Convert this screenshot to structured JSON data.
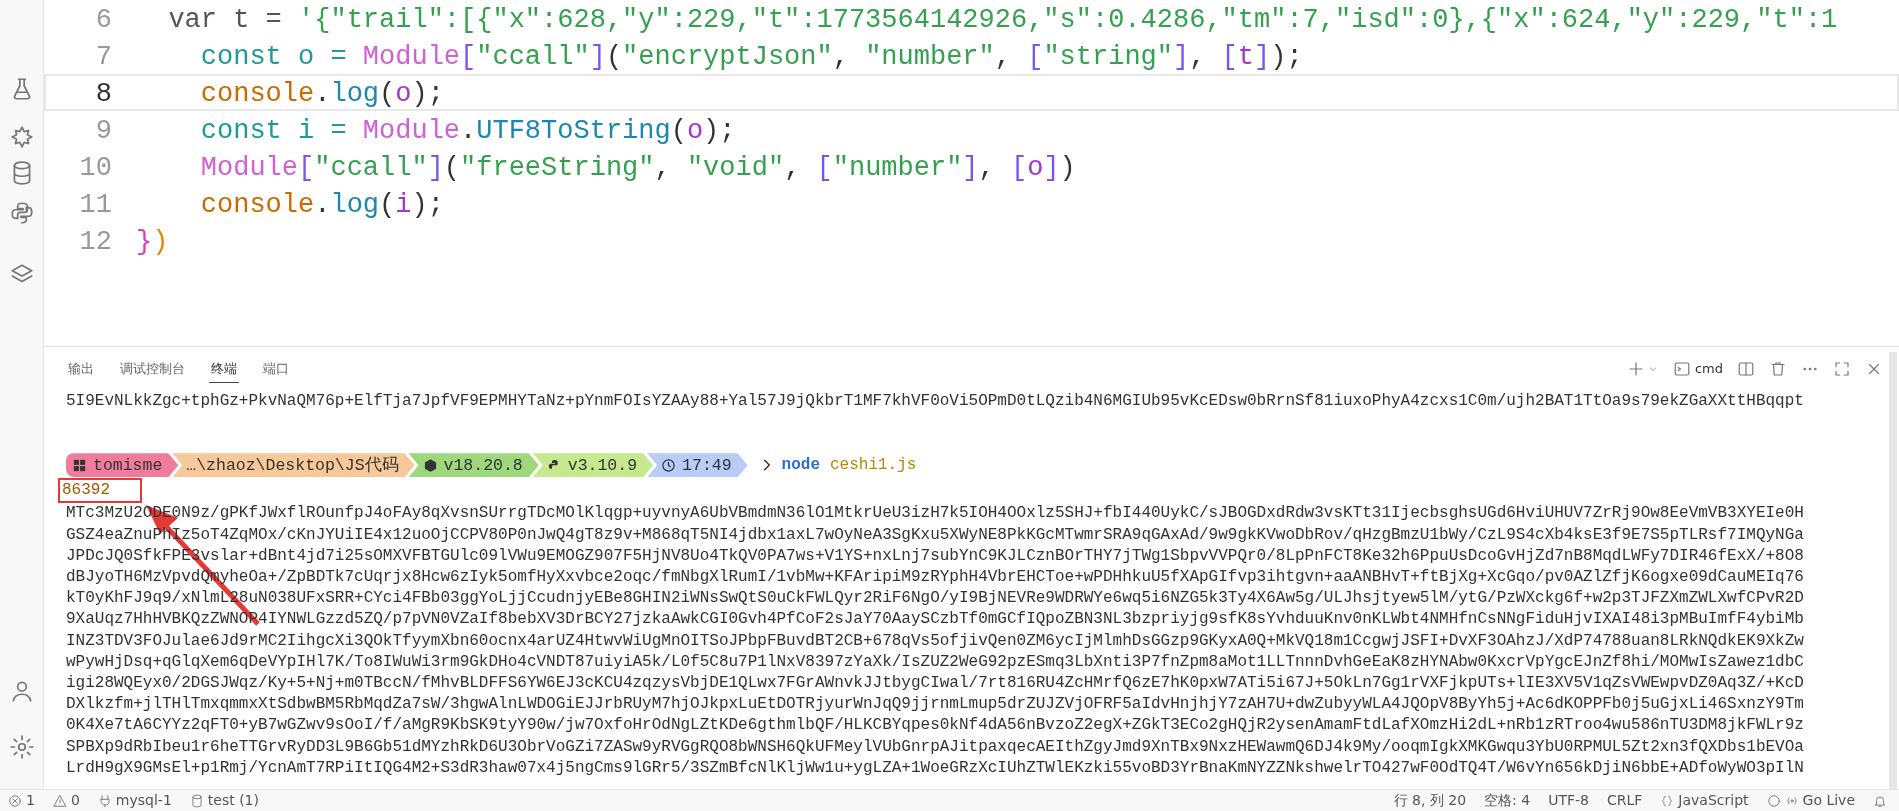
{
  "editor": {
    "lines": [
      {
        "number": "6",
        "current": false,
        "tokens": [
          {
            "text": "  var t = ",
            "kind": "plain"
          },
          {
            "text": "'{\"trail\":[{\"x\":628,\"y\":229,\"t\":1773564142926,\"s\":0.4286,\"tm\":7,\"isd\":0},{\"x\":624,\"y\":229,\"t\":1",
            "kind": "str"
          }
        ]
      },
      {
        "number": "7",
        "current": false,
        "tokens": [
          {
            "text": "    const o = ",
            "kind": "kw"
          },
          {
            "text": "Module",
            "kind": "mod"
          },
          {
            "text": "[",
            "kind": "br"
          },
          {
            "text": "\"ccall\"",
            "kind": "str"
          },
          {
            "text": "]",
            "kind": "br"
          },
          {
            "text": "(",
            "kind": "punc"
          },
          {
            "text": "\"encryptJson\"",
            "kind": "str"
          },
          {
            "text": ", ",
            "kind": "punc"
          },
          {
            "text": "\"number\"",
            "kind": "str"
          },
          {
            "text": ", ",
            "kind": "punc"
          },
          {
            "text": "[",
            "kind": "br"
          },
          {
            "text": "\"string\"",
            "kind": "str"
          },
          {
            "text": "]",
            "kind": "br"
          },
          {
            "text": ", ",
            "kind": "punc"
          },
          {
            "text": "[",
            "kind": "br"
          },
          {
            "text": "t",
            "kind": "param"
          },
          {
            "text": "]",
            "kind": "br"
          },
          {
            "text": ");",
            "kind": "punc"
          }
        ]
      },
      {
        "number": "8",
        "current": true,
        "tokens": [
          {
            "text": "    console",
            "kind": "obj"
          },
          {
            "text": ".",
            "kind": "punc"
          },
          {
            "text": "log",
            "kind": "fn"
          },
          {
            "text": "(",
            "kind": "punc"
          },
          {
            "text": "o",
            "kind": "param"
          },
          {
            "text": ");",
            "kind": "punc"
          }
        ]
      },
      {
        "number": "9",
        "current": false,
        "tokens": [
          {
            "text": "    const i = ",
            "kind": "kw"
          },
          {
            "text": "Module",
            "kind": "mod"
          },
          {
            "text": ".",
            "kind": "punc"
          },
          {
            "text": "UTF8ToString",
            "kind": "fn"
          },
          {
            "text": "(",
            "kind": "punc"
          },
          {
            "text": "o",
            "kind": "param"
          },
          {
            "text": ");",
            "kind": "punc"
          }
        ]
      },
      {
        "number": "10",
        "current": false,
        "tokens": [
          {
            "text": "    Module",
            "kind": "mod"
          },
          {
            "text": "[",
            "kind": "br"
          },
          {
            "text": "\"ccall\"",
            "kind": "str"
          },
          {
            "text": "]",
            "kind": "br"
          },
          {
            "text": "(",
            "kind": "punc"
          },
          {
            "text": "\"freeString\"",
            "kind": "str"
          },
          {
            "text": ", ",
            "kind": "punc"
          },
          {
            "text": "\"void\"",
            "kind": "str"
          },
          {
            "text": ", ",
            "kind": "punc"
          },
          {
            "text": "[",
            "kind": "br"
          },
          {
            "text": "\"number\"",
            "kind": "str"
          },
          {
            "text": "]",
            "kind": "br"
          },
          {
            "text": ", ",
            "kind": "punc"
          },
          {
            "text": "[",
            "kind": "br"
          },
          {
            "text": "o",
            "kind": "param"
          },
          {
            "text": "]",
            "kind": "br"
          },
          {
            "text": ")",
            "kind": "punc"
          }
        ]
      },
      {
        "number": "11",
        "current": false,
        "tokens": [
          {
            "text": "    console",
            "kind": "obj"
          },
          {
            "text": ".",
            "kind": "punc"
          },
          {
            "text": "log",
            "kind": "fn"
          },
          {
            "text": "(",
            "kind": "punc"
          },
          {
            "text": "i",
            "kind": "param"
          },
          {
            "text": ");",
            "kind": "punc"
          }
        ]
      },
      {
        "number": "12",
        "current": false,
        "tokens": [
          {
            "text": "}",
            "kind": "brace1"
          },
          {
            "text": ")",
            "kind": "brace2"
          }
        ]
      }
    ]
  },
  "panel": {
    "tabs": [
      {
        "label": "输出",
        "selected": false
      },
      {
        "label": "调试控制台",
        "selected": false
      },
      {
        "label": "终端",
        "selected": true
      },
      {
        "label": "端口",
        "selected": false
      }
    ],
    "shell": "cmd",
    "terminal": {
      "previous_output": "5I9EvNLkkZgc+tphGz+PkvNaQM76p+ElfTja7JpfVF9EPMHYTaNz+pYnmFOIsYZAAy88+Yal57J9jQkbrT1MF7khVF0oVi5OPmD0tLQzib4N6MGIUb95vKcEDsw0bRrnSf81iuxoPhyA4zcxs1C0m/ujh2BAT1TtOa9s79ekZGaXXttHBqqpt",
      "prompt": [
        {
          "text": "tomisme",
          "kind": "user"
        },
        {
          "text": "…\\zhaoz\\Desktop\\JS代码",
          "kind": "path"
        },
        {
          "text": "v18.20.8",
          "kind": "node"
        },
        {
          "text": "v3.10.9",
          "kind": "python"
        },
        {
          "text": "17:49",
          "kind": "time"
        }
      ],
      "command": "node",
      "argument": "ceshi1.js",
      "result": "86392",
      "output": [
        "MTc3MzU2ODE0N9z/gPKfJWxflROunfpJ4oFAy8qXvsnSUrrgTDcMOlKlqgp+uyvnyA6UbVBmdmN36lO1MtkrUeU3izH7k5IOH4OOxlz5SHJ+fbI440UykC/sJBOGDxdRdw3vsKTt31IjecbsghsUGd6HviUHUV7ZrRj9Ow8EeVmVB3XYEIe0H",
        "GSZ4eaZnuPhIz5oT4ZqMOx/cKnJYUiIE4x12uoOjCCPV80P0nJwQ4gT8z9v+M868qT5NI4jdbx1axL7wOyNeA3SgKxu5XWyNE8PkKGcMTwmrSRA9qGAxAd/9w9gkKVwoDbRov/qHzgBmzU1bWy/CzL9S4cXb4ksE3f9E7S5pTLRsf7IMQyNGa",
        "JPDcJQ0SfkFPE3vslar+dBnt4jd7i25sOMXVFBTGUlc09lVWu9EMOGZ907F5HjNV8Uo4TkQV0PA7ws+V1YS+nxLnj7subYnC9KJLCznBOrTHY7jTWg1SbpvVVPQr0/8LpPnFCT8Ke32h6PpuUsDcoGvHjZd7nB8MqdLWFy7DIR46fExX/+8O8",
        "dBJyoTH6MzVpvdQmyheOa+/ZpBDTk7cUqrjx8Hcw6zIyk5omfHyXxvbce2oqc/fmNbgXlRumI/1vbMw+KFAripiM9zRYphH4VbrEHCToe+wPDHhkuU5fXApGIfvp3ihtgvn+aaANBHvT+ftBjXg+XcGqo/pv0AZlZfjK6ogxe09dCauMEIq76",
        "kT0yKhFJ9q9/xNlmL28uN038UFxSRR+CYci4FBb03ggYoLjjCcudnjyEBe8GHIN2iWNsSwQtS0uCkFWLQyr2RiF6NgO/yI9BjNEVRe9WDRWYe6wq5i6NZG5k3Ty4X6Aw5g/ULJhsjtyew5lM/ytG/PzWXckg6f+w2p3TJFZXmZWLXwfCPvR2D",
        "9XaUqz7HhHVBKQzZWNOP4IYNWLGzzd5ZQ/p7pVN0VZaIf8bebXV3DrBCY27jzkaAwkCGI0Gvh4PfCoF2sJaY70AaySCzbTf0mGCfIQpoZBN3NL3bzpriyjg9sfK8sYvhduuKnv0nKLWbt4NMHfnCsNNgFiduHjvIXAI48i3pMBuImfF4ybiMb",
        "INZ3TDV3FOJulae6Jd9rMC2IihgcXi3QOkTfyymXbn60ocnx4arUZ4HtwvWiUgMnOITSoJPbpFBuvdBT2CB+678qVs5ofjivQen0ZM6ycIjMlmhDsGGzp9GKyxA0Q+MkVQ18m1CcgwjJSFI+DvXF3OAhzJ/XdP74788uan8LRkNQdkEK9XkZw",
        "wPywHjDsq+qGlqXem6qDeVYpIHl7K/To8IWuWi3rm9GkDHo4cVNDT87uiyiA5k/L0f5C8u7P1lNxV8397zYaXk/IsZUZ2WeG92pzESmq3LbXnti3P7fnZpm8aMot1LLTnnnDvhGeEaK8zHYNAbw0KxcrVpYgcEJnZf8hi/MOMwIsZawez1dbC",
        "igi28WQEyx0/2DGSJWqz/Ky+5+Nj+m0TBccN/fMhvBLDFFS6YW6EJ3cKCU4zqzysVbjDE1QLwx7FGrAWnvkJJtbygCIwal/7rt816RU4ZcHMrfQ6zE7hK0pxW7ATi5i67J+5OkLn7Gg1rVXFjkpUTs+lIE3XV5V1qZsVWEwpvDZ0Aq3Z/+KcD",
        "DXlkzfm+jlTHlTmxqmmxXtSdbwBM5RbMqdZa7sW/3hgwAlnLWDOGiEJJrbRUyM7hjOJkpxLuEtDOTRjyurWnJqQ9jjrnmLmup5drZUJZVjOFRF5aIdvHnjhjY7zAH7U+dwZubyyWLA4JQOpV8ByYh5j+Ac6dKOPPFb0j5uGjxLi46SxnzY9Tm",
        "0K4Xe7tA6CYYz2qFT0+yB7wGZwv9sOoI/f/aMgR9KbSK9tyY90w/jw7OxfoHrOdNgLZtKDe6gthmlbQF/HLKCBYqpes0kNf4dA56nBvzoZ2egX+ZGkT3ECo2gHQjR2ysenAmamFtdLafXOmzHi2dL+nRb1zRTroo4wu586nTU3DM8jkFWLr9z",
        "SPBXp9dRbIbeu1r6heTTGrvRyDD3L9B6Gb51dMYzhRkD6U3ObrVoGZi7ZASw9yRVGgRQO8bWNSH6QkUFMeylVUbGnrpAJitpaxqecAEIthZgyJmd9XnTBx9NxzHEWawmQ6DJ4k9My/ooqmIgkXMKGwqu3YbU0RPMUL5Zt2xn3fQXDbs1bEVOa",
        "LrdH9gX9GMsEl+p1Rmj/YcnAmT7RPiItIQG4M2+S3dR3haw07x4j5ngCms9lGRr5/3SZmBfcNlKljWw1u+ygLZA+1WoeGRzXcIUhZTWlEKzki55voBD3YrBnaKmNYZZNkshwelrTO427wF0OdTQ4T/W6vYn656kDjiN6bbE+ADfoWyWO3pIlN"
      ]
    }
  },
  "status_bar": {
    "errors": "1",
    "warnings": "0",
    "connection": "mysql-1",
    "database": "test (1)",
    "position": "行 8, 列 20",
    "indent": "空格: 4",
    "encoding": "UTF-8",
    "line_ending": "CRLF",
    "language": "JavaScript",
    "live_server": "Go Live"
  }
}
